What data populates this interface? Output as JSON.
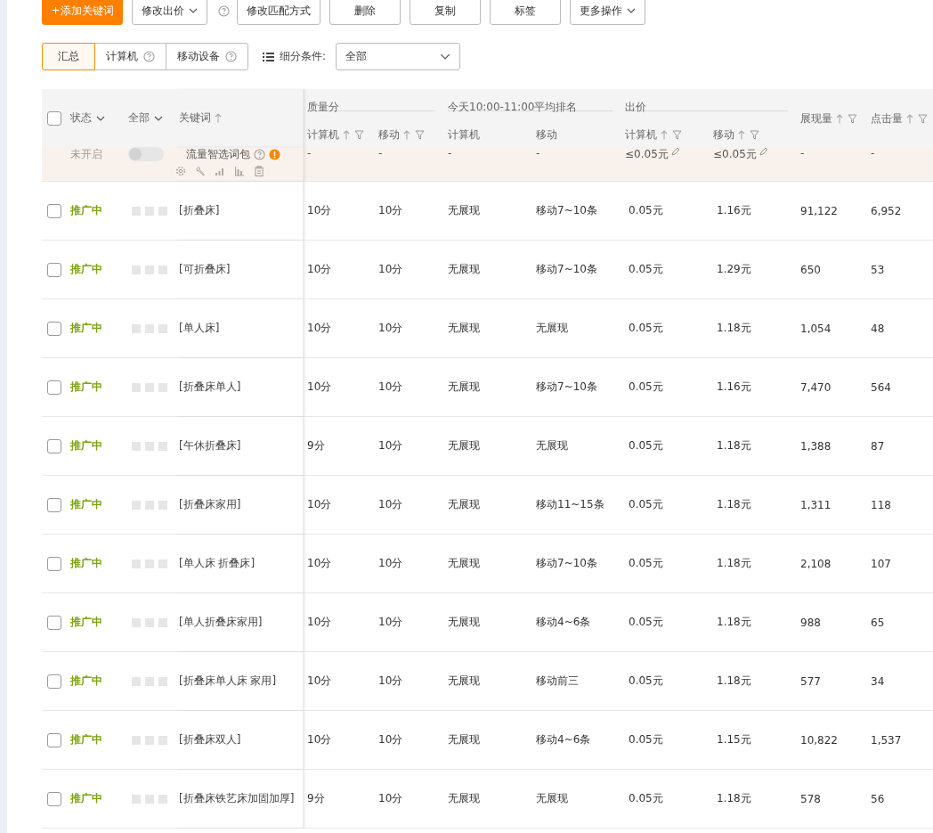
{
  "toolbar": [
    {
      "label": "+添加关键词",
      "kind": "primary",
      "dropdown": false
    },
    {
      "label": "修改出价",
      "kind": "plain",
      "dropdown": true
    },
    {
      "kind": "help"
    },
    {
      "label": "修改匹配方式",
      "kind": "plain",
      "dropdown": false
    },
    {
      "label": "删除",
      "kind": "plain",
      "dropdown": false
    },
    {
      "label": "复制",
      "kind": "plain",
      "dropdown": false
    },
    {
      "label": "标签",
      "kind": "plain",
      "dropdown": false
    },
    {
      "label": "更多操作",
      "kind": "plain",
      "dropdown": true
    }
  ],
  "tabs": [
    {
      "label": "汇总",
      "selected": true,
      "help": false
    },
    {
      "label": "计算机",
      "selected": false,
      "help": true
    },
    {
      "label": "移动设备",
      "selected": false,
      "help": true
    }
  ],
  "filter": {
    "label": "细分条件:",
    "value": "全部"
  },
  "table": {
    "header": {
      "checked": false,
      "status": "状态",
      "scope": "全部",
      "keyword": "关键词",
      "groups": [
        {
          "label": "质量分",
          "columns": [
            {
              "label": "计算机",
              "sort": true,
              "filter": true
            },
            {
              "label": "移动",
              "sort": true,
              "filter": true
            }
          ]
        },
        {
          "label": "今天10:00-11:00平均排名",
          "columns": [
            {
              "label": "计算机",
              "sort": false,
              "filter": false
            },
            {
              "label": "移动",
              "sort": false,
              "filter": false
            }
          ]
        },
        {
          "label": "出价",
          "columns": [
            {
              "label": "计算机",
              "sort": true,
              "filter": true
            },
            {
              "label": "移动",
              "sort": true,
              "filter": true
            }
          ]
        }
      ],
      "columns": [
        {
          "label": "展现量",
          "sort": true,
          "filter": true
        },
        {
          "label": "点击量",
          "sort": true,
          "filter": true
        }
      ]
    },
    "package_row": {
      "status": "未开启",
      "on": false,
      "name": "流量智选词包",
      "cells": [
        {
          "text": "-",
          "editable": false
        },
        {
          "text": "-",
          "editable": false
        },
        {
          "text": "-",
          "editable": false
        },
        {
          "text": "-",
          "editable": false
        },
        {
          "text": "≤0.05元",
          "editable": true
        },
        {
          "text": "≤0.05元",
          "editable": true
        },
        {
          "text": "-",
          "editable": false
        },
        {
          "text": "-",
          "editable": false
        }
      ]
    },
    "rows": [
      {
        "checked": false,
        "status": "推广中",
        "keyword": "[折叠床]",
        "cells": [
          "10分",
          "10分",
          "无展现",
          "移动7~10条",
          "0.05元",
          "1.16元",
          "91,122",
          "6,952"
        ]
      },
      {
        "checked": false,
        "status": "推广中",
        "keyword": "[可折叠床]",
        "cells": [
          "10分",
          "10分",
          "无展现",
          "移动7~10条",
          "0.05元",
          "1.29元",
          "650",
          "53"
        ]
      },
      {
        "checked": false,
        "status": "推广中",
        "keyword": "[单人床]",
        "cells": [
          "10分",
          "10分",
          "无展现",
          "无展现",
          "0.05元",
          "1.18元",
          "1,054",
          "48"
        ]
      },
      {
        "checked": false,
        "status": "推广中",
        "keyword": "[折叠床单人]",
        "cells": [
          "10分",
          "10分",
          "无展现",
          "移动7~10条",
          "0.05元",
          "1.16元",
          "7,470",
          "564"
        ]
      },
      {
        "checked": false,
        "status": "推广中",
        "keyword": "[午休折叠床]",
        "cells": [
          "9分",
          "10分",
          "无展现",
          "无展现",
          "0.05元",
          "1.18元",
          "1,388",
          "87"
        ]
      },
      {
        "checked": false,
        "status": "推广中",
        "keyword": "[折叠床家用]",
        "cells": [
          "10分",
          "10分",
          "无展现",
          "移动11~15条",
          "0.05元",
          "1.18元",
          "1,311",
          "118"
        ]
      },
      {
        "checked": false,
        "status": "推广中",
        "keyword": "[单人床 折叠床]",
        "cells": [
          "10分",
          "10分",
          "无展现",
          "移动7~10条",
          "0.05元",
          "1.18元",
          "2,108",
          "107"
        ]
      },
      {
        "checked": false,
        "status": "推广中",
        "keyword": "[单人折叠床家用]",
        "cells": [
          "10分",
          "10分",
          "无展现",
          "移动4~6条",
          "0.05元",
          "1.18元",
          "988",
          "65"
        ]
      },
      {
        "checked": false,
        "status": "推广中",
        "keyword": "[折叠床单人床 家用]",
        "cells": [
          "10分",
          "10分",
          "无展现",
          "移动前三",
          "0.05元",
          "1.18元",
          "577",
          "34"
        ]
      },
      {
        "checked": false,
        "status": "推广中",
        "keyword": "[折叠床双人]",
        "cells": [
          "10分",
          "10分",
          "无展现",
          "移动4~6条",
          "0.05元",
          "1.15元",
          "10,822",
          "1,537"
        ]
      },
      {
        "checked": false,
        "status": "推广中",
        "keyword": "[折叠床铁艺床加固加厚]",
        "cells": [
          "9分",
          "10分",
          "无展现",
          "无展现",
          "0.05元",
          "1.18元",
          "578",
          "56"
        ]
      }
    ]
  }
}
